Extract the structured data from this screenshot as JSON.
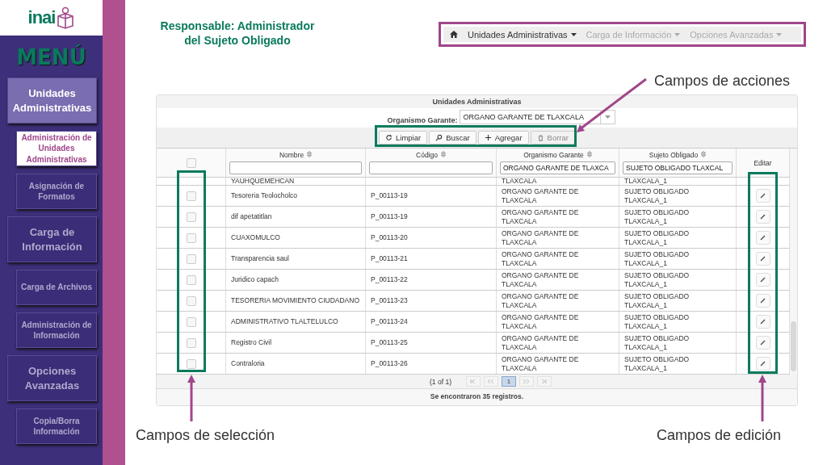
{
  "logo": {
    "text": "inai"
  },
  "sidebar": {
    "title": "MENÚ",
    "items": [
      {
        "label": "Unidades Administrativas",
        "kind": "main",
        "selected": true
      },
      {
        "label": "Administración de Unidades Administrativas",
        "kind": "sub",
        "selected": true
      },
      {
        "label": "Asignación de Formatos",
        "kind": "sub",
        "selected": false
      },
      {
        "label": "Carga de Información",
        "kind": "main",
        "selected": false
      },
      {
        "label": "Carga de Archivos",
        "kind": "sub",
        "selected": false
      },
      {
        "label": "Administración de Información",
        "kind": "sub",
        "selected": false
      },
      {
        "label": "Opciones Avanzadas",
        "kind": "main",
        "selected": false
      },
      {
        "label": "Copia/Borra Información",
        "kind": "sub",
        "selected": false
      }
    ]
  },
  "heading": "Responsable: Administrador del Sujeto Obligado",
  "navbar": {
    "items": [
      {
        "label": "Unidades Administrativas",
        "disabled": false
      },
      {
        "label": "Carga de Información",
        "disabled": true
      },
      {
        "label": "Opciones Avanzadas",
        "disabled": true
      }
    ]
  },
  "panel": {
    "title": "Unidades Administrativas",
    "organismo_label": "Organismo Garante:",
    "organismo_value": "ORGANO GARANTE DE TLAXCALA",
    "buttons": [
      {
        "label": "Limpiar",
        "kind": "refresh",
        "disabled": false
      },
      {
        "label": "Buscar",
        "kind": "search",
        "disabled": false
      },
      {
        "label": "Agregar",
        "kind": "plus",
        "disabled": false
      },
      {
        "label": "Borrar",
        "kind": "trash",
        "disabled": true
      }
    ]
  },
  "table": {
    "select_all": {
      "checked": false
    },
    "columns": [
      {
        "label": "Nombre"
      },
      {
        "label": "Código"
      },
      {
        "label": "Organismo Garante",
        "filter": "ORGANO GARANTE DE TLAXCA"
      },
      {
        "label": "Sujeto Obligado",
        "filter": "SUJETO OBLIGADO TLAXCAL"
      }
    ],
    "edit_header": "Editar",
    "partial_row": {
      "nombre": "YAUHQUEMEHCAN",
      "organismo": "TLAXCALA",
      "sujeto": "TLAXCALA_1"
    },
    "rows": [
      {
        "nombre": "Tesoreria Teolocholco",
        "codigo": "P_00113-19",
        "organismo": "ORGANO GARANTE DE TLAXCALA",
        "sujeto": "SUJETO OBLIGADO TLAXCALA_1",
        "checked": false
      },
      {
        "nombre": "dif apetatitlan",
        "codigo": "P_00113-19",
        "organismo": "ORGANO GARANTE DE TLAXCALA",
        "sujeto": "SUJETO OBLIGADO TLAXCALA_1",
        "checked": false
      },
      {
        "nombre": "CUAXOMULCO",
        "codigo": "P_00113-20",
        "organismo": "ORGANO GARANTE DE TLAXCALA",
        "sujeto": "SUJETO OBLIGADO TLAXCALA_1",
        "checked": false
      },
      {
        "nombre": "Transparencia saul",
        "codigo": "P_00113-21",
        "organismo": "ORGANO GARANTE DE TLAXCALA",
        "sujeto": "SUJETO OBLIGADO TLAXCALA_1",
        "checked": false
      },
      {
        "nombre": "Juridico capach",
        "codigo": "P_00113-22",
        "organismo": "ORGANO GARANTE DE TLAXCALA",
        "sujeto": "SUJETO OBLIGADO TLAXCALA_1",
        "checked": false
      },
      {
        "nombre": "TESORERIA MOVIMIENTO CIUDADANO",
        "codigo": "P_00113-23",
        "organismo": "ORGANO GARANTE DE TLAXCALA",
        "sujeto": "SUJETO OBLIGADO TLAXCALA_1",
        "checked": false
      },
      {
        "nombre": "ADMINISTRATIVO TLALTELULCO",
        "codigo": "P_00113-24",
        "organismo": "ORGANO GARANTE DE TLAXCALA",
        "sujeto": "SUJETO OBLIGADO TLAXCALA_1",
        "checked": false
      },
      {
        "nombre": "Registro Civil",
        "codigo": "P_00113-25",
        "organismo": "ORGANO GARANTE DE TLAXCALA",
        "sujeto": "SUJETO OBLIGADO TLAXCALA_1",
        "checked": false
      },
      {
        "nombre": "Contraloria",
        "codigo": "P_00113-26",
        "organismo": "ORGANO GARANTE DE TLAXCALA",
        "sujeto": "SUJETO OBLIGADO TLAXCALA_1",
        "checked": false
      }
    ]
  },
  "pagination": {
    "summary": "(1 of 1)",
    "pages": [
      {
        "label": "1",
        "selected": true
      }
    ]
  },
  "status": "Se encontraron 35 registros.",
  "annotations": [
    {
      "kind": "actions",
      "label": "Campos de acciones"
    },
    {
      "kind": "selection",
      "label": "Campos de selección"
    },
    {
      "kind": "edit",
      "label": "Campos de edición"
    }
  ]
}
